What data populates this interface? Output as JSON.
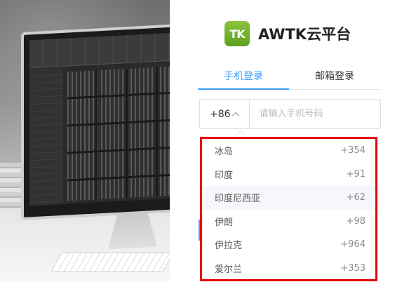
{
  "brand": {
    "logo_text": "TK",
    "name": "AWTK云平台",
    "logo_color": "#6fb12c"
  },
  "tabs": [
    {
      "label": "手机登录",
      "active": true
    },
    {
      "label": "邮箱登录",
      "active": false
    }
  ],
  "accent_color": "#409eff",
  "highlight_border_color": "#e8000b",
  "phone": {
    "country_code": "+86",
    "placeholder": "请输入手机号码",
    "value": ""
  },
  "country_dropdown": {
    "options": [
      {
        "name": "冰岛",
        "code": "+354"
      },
      {
        "name": "印度",
        "code": "+91"
      },
      {
        "name": "印度尼西亚",
        "code": "+62",
        "hovered": true
      },
      {
        "name": "伊朗",
        "code": "+98"
      },
      {
        "name": "伊拉克",
        "code": "+964"
      },
      {
        "name": "爱尔兰",
        "code": "+353"
      }
    ]
  }
}
